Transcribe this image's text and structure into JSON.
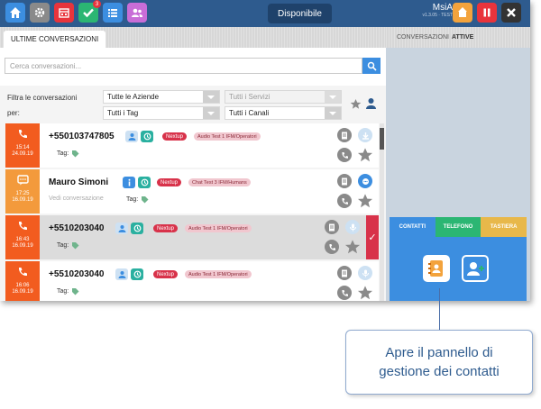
{
  "topbar": {
    "status": "Disponibile",
    "user_name": "MsiA",
    "version": "v1.3.05 · TEST",
    "notification_count": "3",
    "colors": {
      "bar": "#2e5b8e",
      "home": "#3c8ee0",
      "settings": "#8a8a8a",
      "calendar": "#e8343c",
      "tasks": "#2bb673",
      "list": "#3c8ee0",
      "contacts": "#c86dd7",
      "logout": "#f3a33c",
      "pause": "#e8343c",
      "close": "#333333"
    }
  },
  "left": {
    "tab_label": "ULTIME CONVERSAZIONI",
    "search_placeholder": "Cerca conversazioni...",
    "filter_label_1": "Filtra le conversazioni",
    "filter_label_2": "per:",
    "select_aziende": "Tutte le Aziende",
    "select_servizi": "Tutti i Servizi",
    "select_tag": "Tutti i Tag",
    "select_canali": "Tutti i Canali"
  },
  "conversations": [
    {
      "number": "+550103747805",
      "time": "15:14",
      "date": "24.09.19",
      "tag1": "Nextup",
      "tag2": "Audio Test 1 IFM/Operatori",
      "tag_label": "Tag:",
      "side_color": "#f25c1f",
      "channel": "phone-icon"
    },
    {
      "number": "Mauro Simoni",
      "time": "17:25",
      "date": "16.09.19",
      "tag1": "Nextup",
      "tag2": "Chat Test 3 IFM/Humans",
      "tag_label": "Tag:",
      "extra": "Vedi conversazione",
      "side_color": "#f39a3c",
      "channel": "chat-icon"
    },
    {
      "number": "+5510203040",
      "time": "16:43",
      "date": "16.09.19",
      "tag1": "Nextup",
      "tag2": "Audio Test 1 IFM/Operatori",
      "tag_label": "Tag:",
      "side_color": "#f25c1f",
      "channel": "phone-icon"
    },
    {
      "number": "+5510203040",
      "time": "16:06",
      "date": "16.09.19",
      "tag1": "Nextup",
      "tag2": "Audio Test 1 IFM/Operatori",
      "tag_label": "Tag:",
      "side_color": "#f25c1f",
      "channel": "phone-icon"
    }
  ],
  "right": {
    "header_prefix": "CONVERSAZIONI",
    "header_bold": "ATTIVE",
    "tab_contatti": "CONTATTI",
    "tab_telefono": "TELEFONO",
    "tab_tastiera": "TASTIERA",
    "colors": {
      "contatti": "#3c8ee0",
      "telefono": "#2bb673",
      "tastiera": "#e8b84a"
    }
  },
  "callout": {
    "text": "Apre il pannello di gestione dei contatti"
  }
}
